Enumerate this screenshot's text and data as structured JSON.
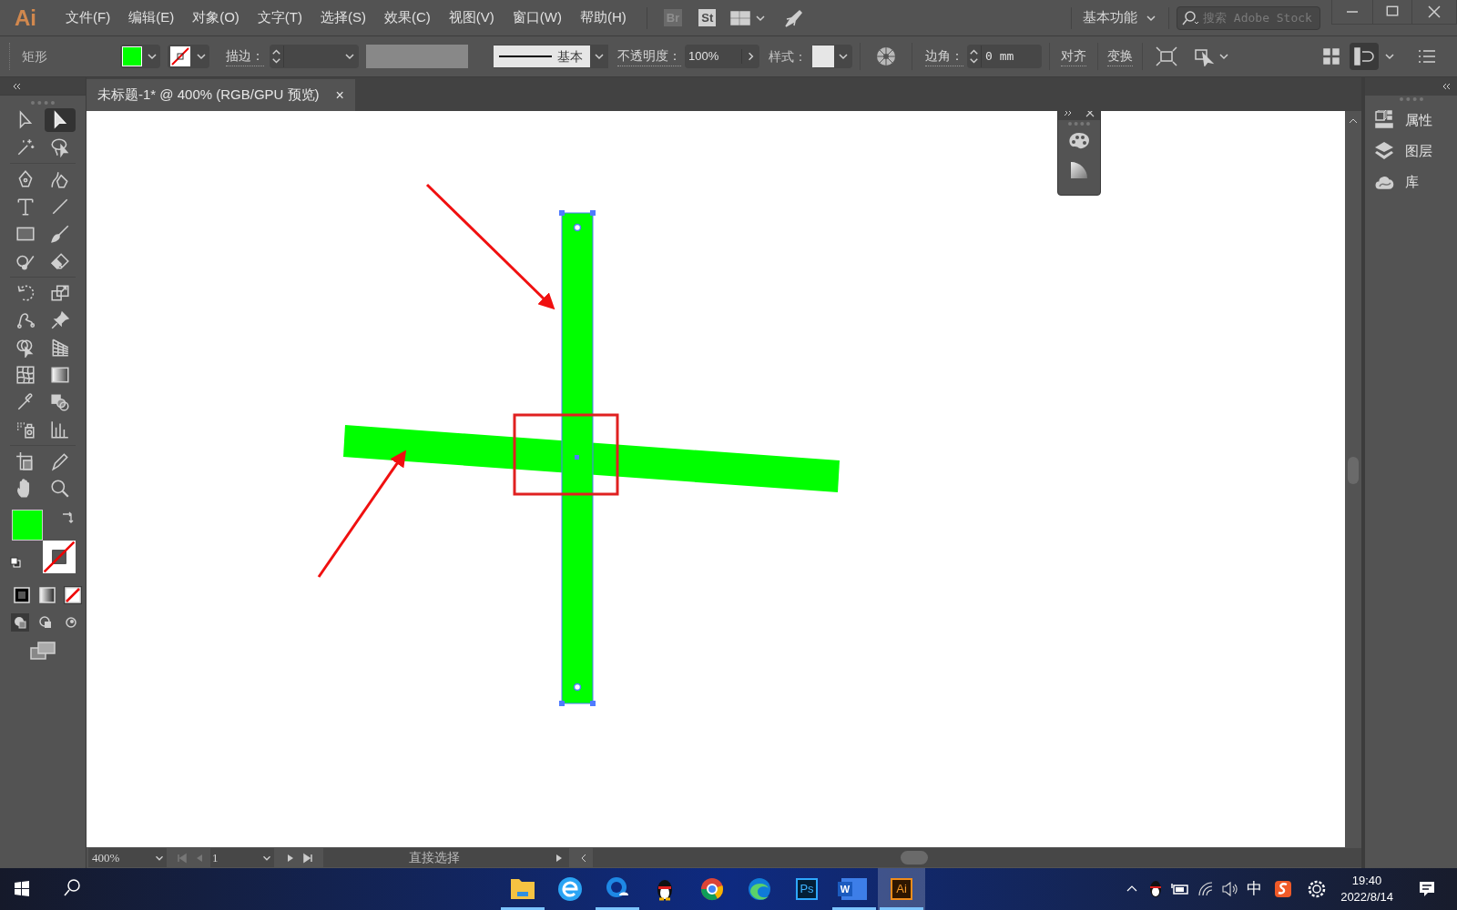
{
  "app": {
    "logo": "Ai",
    "menus": [
      "文件(F)",
      "编辑(E)",
      "对象(O)",
      "文字(T)",
      "选择(S)",
      "效果(C)",
      "视图(V)",
      "窗口(W)",
      "帮助(H)"
    ],
    "bridge": "Br",
    "stock": "St",
    "workspace": "基本功能",
    "search": {
      "placeholder": "搜索 Adobe Stock"
    }
  },
  "control_bar": {
    "object_type": "矩形",
    "stroke_label": "描边：",
    "stroke_style": "基本",
    "opacity_label": "不透明度：",
    "opacity": "100%",
    "style_label": "样式：",
    "corner_label": "边角：",
    "corner": "0 mm",
    "align": "对齐",
    "transform": "变换"
  },
  "document_tab": {
    "title": "未标题-1* @ 400% (RGB/GPU 预览)",
    "close": "×"
  },
  "tools": [
    {
      "selected": false
    },
    {
      "selected": true
    },
    {
      "selected": false
    },
    {
      "selected": false
    },
    {
      "selected": false
    },
    {
      "selected": false
    },
    {
      "selected": false
    },
    {
      "selected": false
    },
    {
      "selected": false
    },
    {
      "selected": false
    },
    {
      "selected": false
    },
    {
      "selected": false
    },
    {
      "selected": false
    },
    {
      "selected": false
    },
    {
      "selected": false
    },
    {
      "selected": false
    },
    {
      "selected": false
    },
    {
      "selected": false
    },
    {
      "selected": false
    },
    {
      "selected": false
    },
    {
      "selected": false
    },
    {
      "selected": false
    },
    {
      "selected": false
    },
    {
      "selected": false
    },
    {
      "selected": false
    },
    {
      "selected": false
    },
    {
      "selected": false
    },
    {
      "selected": false
    }
  ],
  "right_panel": [
    {
      "label": "属性"
    },
    {
      "label": "图层"
    },
    {
      "label": "库"
    }
  ],
  "status_bar": {
    "zoom": "400%",
    "artboard": "1",
    "tool_name": "直接选择"
  },
  "taskbar": {
    "apps": [
      {
        "kind": "folder",
        "running": true,
        "selected": false
      },
      {
        "kind": "e-browser",
        "running": false,
        "selected": false
      },
      {
        "kind": "cloud-search",
        "running": true,
        "selected": false
      },
      {
        "kind": "penguin",
        "running": false,
        "selected": false
      },
      {
        "kind": "chrome",
        "running": false,
        "selected": false
      },
      {
        "kind": "edge",
        "running": false,
        "selected": false
      },
      {
        "kind": "badge",
        "label": "Ps",
        "running": false,
        "selected": false
      },
      {
        "kind": "word",
        "label": "W",
        "running": true,
        "selected": false
      },
      {
        "kind": "badge-orange",
        "label": "Ai",
        "running": true,
        "selected": true
      }
    ],
    "ime": "中",
    "time": "19:40",
    "date": "2022/8/14"
  }
}
